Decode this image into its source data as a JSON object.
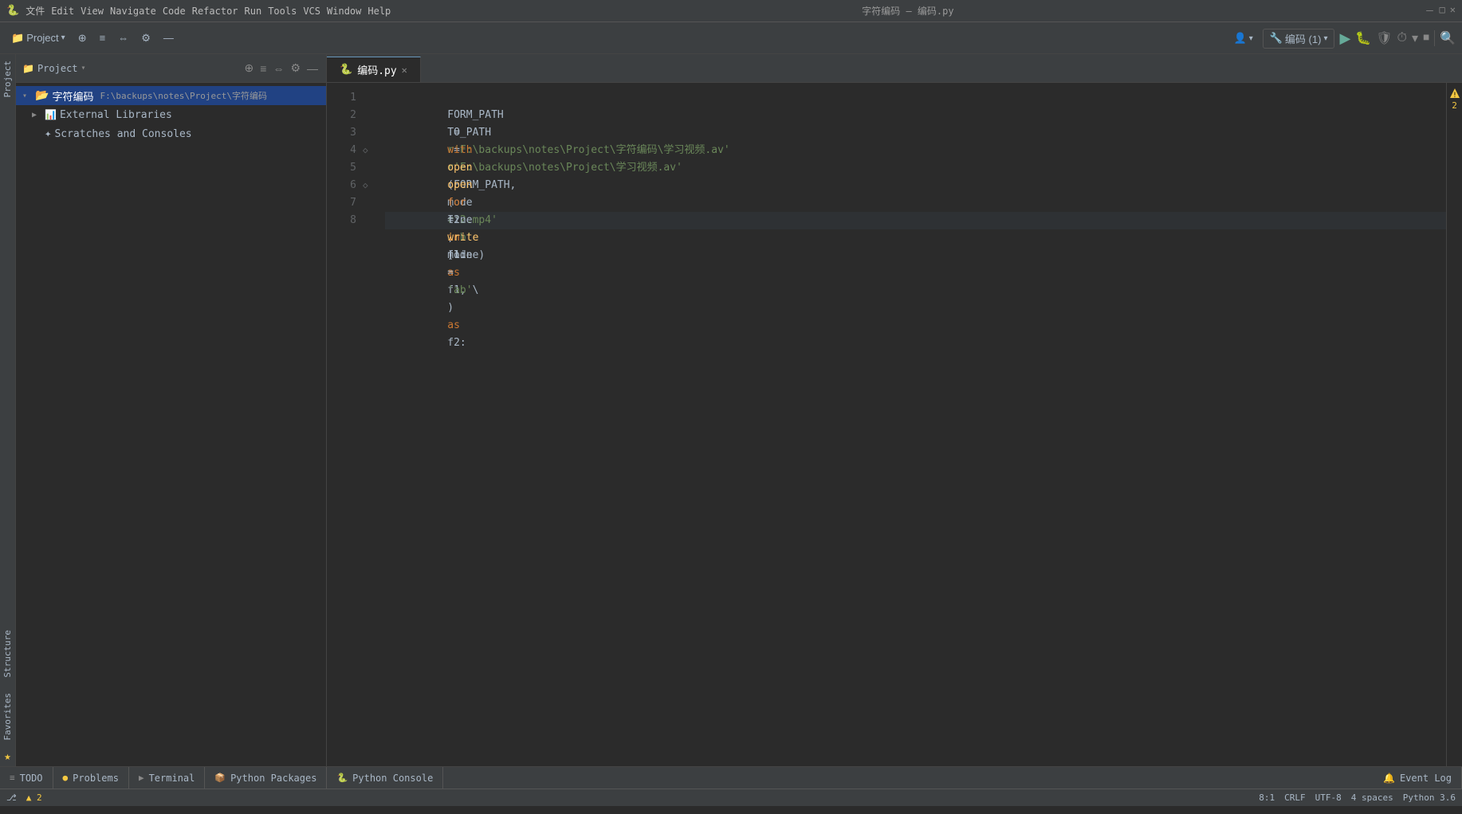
{
  "titlebar": {
    "appname": "编码.py",
    "menus": [
      "文件",
      "Edit",
      "View",
      "Navigate",
      "Code",
      "Refactor",
      "Run",
      "Tools",
      "VCS",
      "Window",
      "Help"
    ],
    "title": "字符编码 – 编码.py"
  },
  "toolbar": {
    "project_label": "Project",
    "run_config": "编码 (1)"
  },
  "project": {
    "title": "Project",
    "root_label": "字符编码",
    "root_path": "F:\\backups\\notes\\Project\\字符编码",
    "items": [
      {
        "label": "字符编码",
        "path": "F:\\backups\\notes\\Project\\字符编码",
        "type": "folder",
        "selected": true,
        "depth": 0
      },
      {
        "label": "External Libraries",
        "type": "folder",
        "selected": false,
        "depth": 0
      },
      {
        "label": "Scratches and Consoles",
        "type": "folder",
        "selected": false,
        "depth": 0
      }
    ]
  },
  "editor": {
    "tab_label": "编码.py",
    "lines": [
      {
        "num": 1,
        "code": "FORM_PATH = r'F:\\backups\\notes\\Project\\字符编码\\学习视频.av'"
      },
      {
        "num": 2,
        "code": "TO_PATH = r'F:\\backups\\notes\\Project\\学习视频.av'"
      },
      {
        "num": 3,
        "code": "with open(FORM_PATH, mode='rb') as f1, \\"
      },
      {
        "num": 4,
        "code": "        open(r'2.mp4', mode='ab') as f2:"
      },
      {
        "num": 5,
        "code": "    for line in f1:"
      },
      {
        "num": 6,
        "code": "        f2.write(line)"
      },
      {
        "num": 7,
        "code": ""
      },
      {
        "num": 8,
        "code": ""
      }
    ]
  },
  "warning": {
    "count": 2,
    "label": "▲ 2"
  },
  "bottom_tabs": [
    {
      "label": "TODO",
      "icon": "≡"
    },
    {
      "label": "Problems",
      "icon": "●"
    },
    {
      "label": "Terminal",
      "icon": "▶"
    },
    {
      "label": "Python Packages",
      "icon": "📦"
    },
    {
      "label": "Python Console",
      "icon": "🐍"
    }
  ],
  "status_bar": {
    "position": "8:1",
    "line_ending": "CRLF",
    "encoding": "UTF-8",
    "indent": "4 spaces",
    "python": "Python 3.6",
    "event": "Event"
  },
  "structure_label": "Structure",
  "favorites_label": "Favorites",
  "colors": {
    "bg": "#2b2b2b",
    "panel_bg": "#3c3f41",
    "accent": "#214283",
    "selected_text": "#ffffff",
    "keyword": "#cc7832",
    "string": "#6a8759",
    "var": "#a9b7c6"
  }
}
